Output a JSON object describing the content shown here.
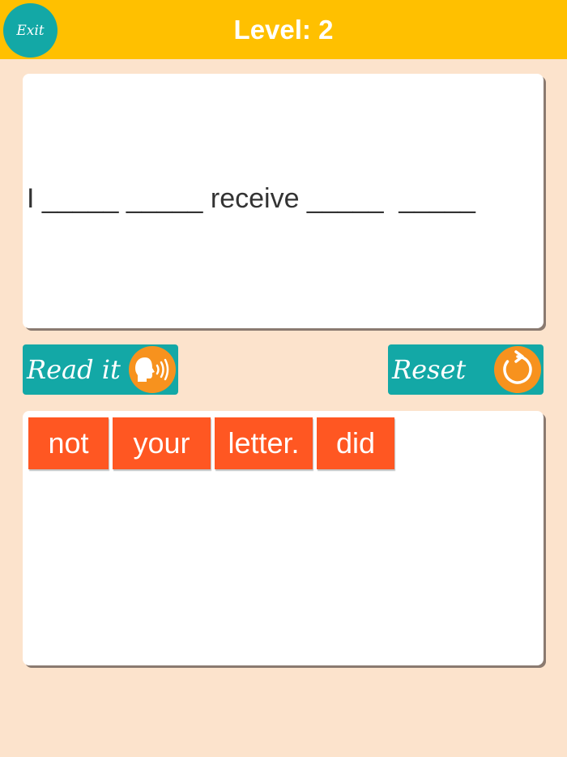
{
  "header": {
    "exit_label": "Exit",
    "level_label": "Level: 2"
  },
  "sentence": {
    "text": "I _____ _____ receive _____  _____"
  },
  "buttons": {
    "read_label": "Read it",
    "reset_label": "Reset"
  },
  "words": [
    "not",
    "your",
    "letter.",
    "did"
  ],
  "colors": {
    "background": "#fce3cc",
    "header": "#ffc000",
    "teal": "#13a8a6",
    "orange_icon": "#f7921e",
    "word_tile": "#ff5722"
  },
  "icons": {
    "exit": "exit-icon",
    "read": "speaking-head-icon",
    "reset": "reset-arrow-icon"
  }
}
